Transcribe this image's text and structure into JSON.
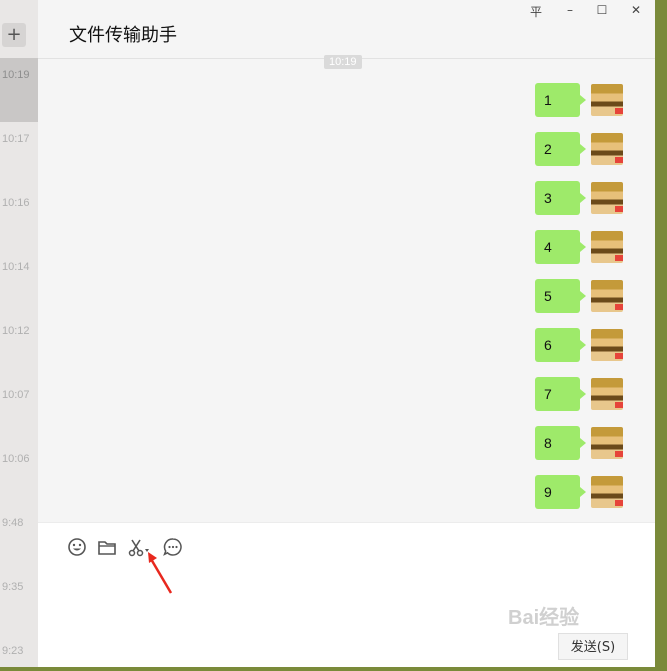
{
  "window": {
    "title": "文件传输助手",
    "controls": [
      "平",
      "–",
      "☐",
      "✕"
    ]
  },
  "sidebar": {
    "add_label": "+",
    "times": [
      "10:19",
      "10:17",
      "10:16",
      "10:14",
      "10:12",
      "10:07",
      "10:06",
      "9:48",
      "9:35",
      "9:23"
    ]
  },
  "chat": {
    "timestamp": "10:19",
    "messages": [
      "1",
      "2",
      "3",
      "4",
      "5",
      "6",
      "7",
      "8",
      "9"
    ]
  },
  "toolbar": {
    "icons": [
      "smiley-icon",
      "folder-icon",
      "scissors-icon",
      "chat-history-icon"
    ]
  },
  "input": {
    "send_label": "发送(S)",
    "watermark": "Bai经验"
  }
}
